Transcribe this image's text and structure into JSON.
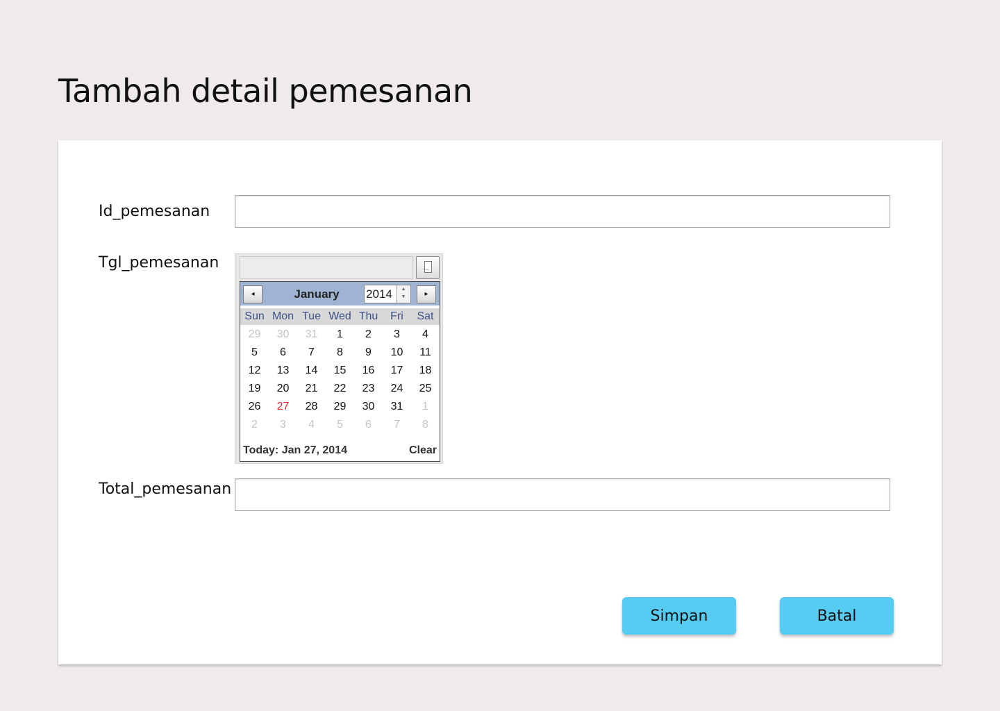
{
  "page": {
    "title": "Tambah detail pemesanan"
  },
  "form": {
    "id_label": "Id_pemesanan",
    "id_value": "",
    "tgl_label": "Tgl_pemesanan",
    "total_label": "Total_pemesanan",
    "total_value": ""
  },
  "calendar": {
    "prev_icon": "◂",
    "next_icon": "▸",
    "month": "January",
    "year": "2014",
    "weekdays": [
      "Sun",
      "Mon",
      "Tue",
      "Wed",
      "Thu",
      "Fri",
      "Sat"
    ],
    "weeks": [
      [
        {
          "d": "29",
          "m": true
        },
        {
          "d": "30",
          "m": true
        },
        {
          "d": "31",
          "m": true
        },
        {
          "d": "1"
        },
        {
          "d": "2"
        },
        {
          "d": "3"
        },
        {
          "d": "4"
        }
      ],
      [
        {
          "d": "5"
        },
        {
          "d": "6"
        },
        {
          "d": "7"
        },
        {
          "d": "8"
        },
        {
          "d": "9"
        },
        {
          "d": "10"
        },
        {
          "d": "11"
        }
      ],
      [
        {
          "d": "12"
        },
        {
          "d": "13"
        },
        {
          "d": "14"
        },
        {
          "d": "15"
        },
        {
          "d": "16"
        },
        {
          "d": "17"
        },
        {
          "d": "18"
        }
      ],
      [
        {
          "d": "19"
        },
        {
          "d": "20"
        },
        {
          "d": "21"
        },
        {
          "d": "22"
        },
        {
          "d": "23"
        },
        {
          "d": "24"
        },
        {
          "d": "25"
        }
      ],
      [
        {
          "d": "26"
        },
        {
          "d": "27",
          "today": true
        },
        {
          "d": "28"
        },
        {
          "d": "29"
        },
        {
          "d": "30"
        },
        {
          "d": "31"
        },
        {
          "d": "1",
          "m": true
        }
      ],
      [
        {
          "d": "2",
          "m": true
        },
        {
          "d": "3",
          "m": true
        },
        {
          "d": "4",
          "m": true
        },
        {
          "d": "5",
          "m": true
        },
        {
          "d": "6",
          "m": true
        },
        {
          "d": "7",
          "m": true
        },
        {
          "d": "8",
          "m": true
        }
      ]
    ],
    "today_label": "Today: Jan 27, 2014",
    "clear_label": "Clear",
    "today_color": "#e8262b"
  },
  "buttons": {
    "save": "Simpan",
    "cancel": "Batal",
    "color": "#56ccf2"
  }
}
